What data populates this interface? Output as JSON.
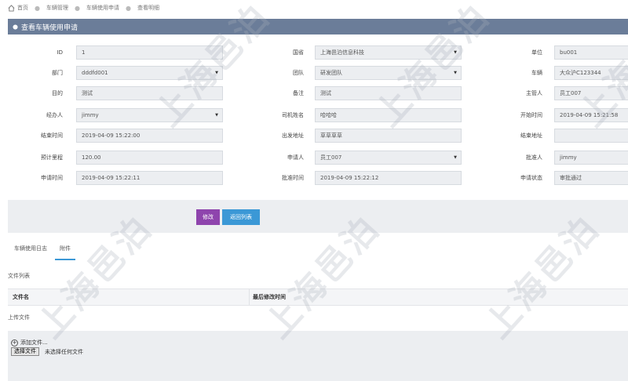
{
  "breadcrumb": [
    "首页",
    "车辆管理",
    "车辆使用申请",
    "查看明细"
  ],
  "panel": {
    "title": "查看车辆使用申请"
  },
  "form": {
    "rows": [
      [
        {
          "label": "ID",
          "value": "1",
          "select": false
        },
        {
          "label": "国省",
          "value": "上海邑泊信息科技",
          "select": true
        },
        {
          "label": "单位",
          "value": "bu001",
          "select": false
        }
      ],
      [
        {
          "label": "部门",
          "value": "dddfd001",
          "select": true
        },
        {
          "label": "团队",
          "value": "研发团队",
          "select": true
        },
        {
          "label": "车辆",
          "value": "大众沪C123344",
          "select": false
        }
      ],
      [
        {
          "label": "目的",
          "value": "测试",
          "select": false
        },
        {
          "label": "备注",
          "value": "测试",
          "select": false
        },
        {
          "label": "主管人",
          "value": "员工007",
          "select": false
        }
      ],
      [
        {
          "label": "经办人",
          "value": "jimmy",
          "select": true
        },
        {
          "label": "司机姓名",
          "value": "哈哈哈",
          "select": false
        },
        {
          "label": "开始时间",
          "value": "2019-04-09 15:21:58",
          "select": false
        }
      ],
      [
        {
          "label": "结束时间",
          "value": "2019-04-09 15:22:00",
          "select": false
        },
        {
          "label": "出发地址",
          "value": "草草草草",
          "select": false
        },
        {
          "label": "结束地址",
          "value": "",
          "select": false
        }
      ],
      [
        {
          "label": "预计里程",
          "value": "120.00",
          "select": false
        },
        {
          "label": "申请人",
          "value": "员工007",
          "select": true
        },
        {
          "label": "批准人",
          "value": "jimmy",
          "select": false
        }
      ],
      [
        {
          "label": "申请时间",
          "value": "2019-04-09 15:22:11",
          "select": false
        },
        {
          "label": "批准时间",
          "value": "2019-04-09 15:22:12",
          "select": false
        },
        {
          "label": "申请状态",
          "value": "审批通过",
          "select": false
        }
      ]
    ]
  },
  "actions": {
    "edit": "修改",
    "back": "返回列表"
  },
  "tabs": [
    "车辆使用日志",
    "附件"
  ],
  "files": {
    "list_title": "文件列表",
    "columns": [
      "文件名",
      "最后修改时间"
    ],
    "upload_title": "上传文件",
    "add_file": "添加文件...",
    "choose_file": "选择文件",
    "no_file": "未选择任何文件"
  },
  "watermark": "上海邑泊"
}
